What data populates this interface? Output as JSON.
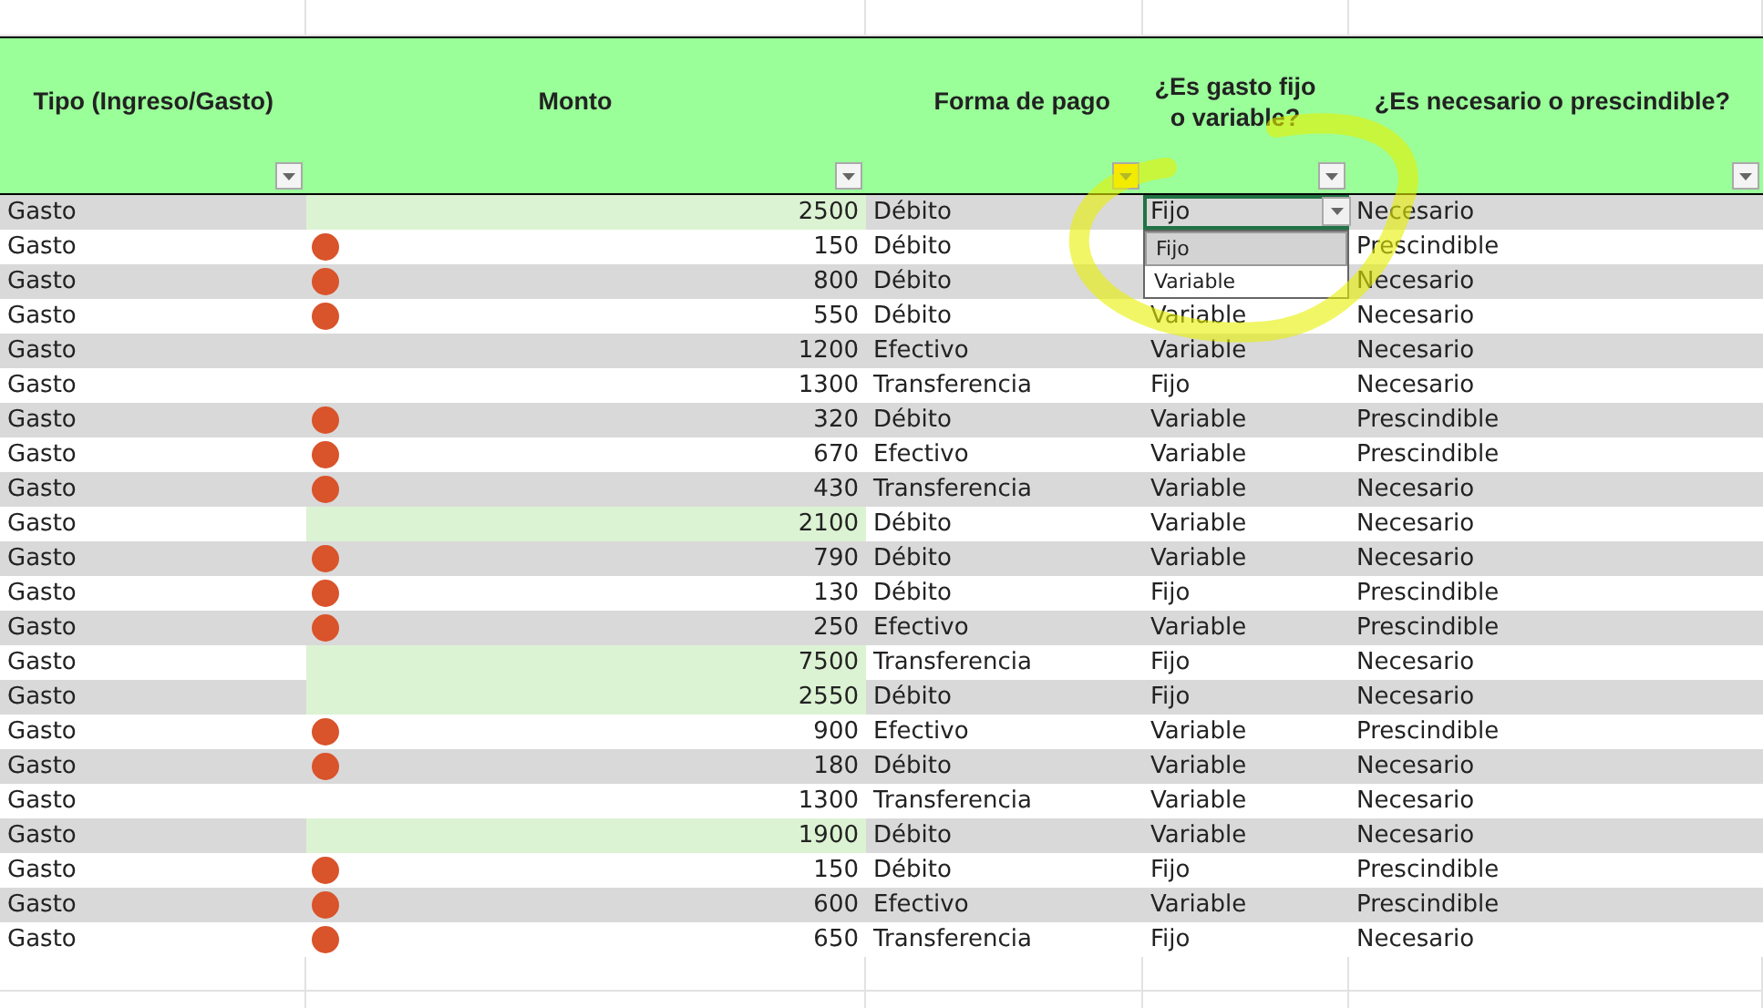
{
  "columns": [
    {
      "label": "Tipo (Ingreso/Gasto)",
      "filter_active": false
    },
    {
      "label": "Monto",
      "filter_active": false
    },
    {
      "label": "Forma de pago",
      "filter_active": true
    },
    {
      "label": "¿Es gasto fijo o variable?",
      "filter_active": false
    },
    {
      "label": "¿Es necesario o prescindible?",
      "filter_active": false
    }
  ],
  "rows": [
    {
      "tipo": "Gasto",
      "monto": "2500",
      "kind": "fill",
      "pago": "Débito",
      "fijo": "Fijo",
      "necesidad": "Necesario",
      "selected": true
    },
    {
      "tipo": "Gasto",
      "monto": "150",
      "kind": "dot",
      "pago": "Débito",
      "necesidad": "Prescindible",
      "selected": false
    },
    {
      "tipo": "Gasto",
      "monto": "800",
      "kind": "dot",
      "pago": "Débito",
      "necesidad": "Necesario",
      "selected": false
    },
    {
      "tipo": "Gasto",
      "monto": "550",
      "kind": "dot",
      "pago": "Débito",
      "fijo": "Variable",
      "necesidad": "Necesario",
      "selected": false
    },
    {
      "tipo": "Gasto",
      "monto": "1200",
      "kind": "none",
      "pago": "Efectivo",
      "fijo": "Variable",
      "necesidad": "Necesario",
      "selected": false
    },
    {
      "tipo": "Gasto",
      "monto": "1300",
      "kind": "none",
      "pago": "Transferencia",
      "fijo": "Fijo",
      "necesidad": "Necesario",
      "selected": false
    },
    {
      "tipo": "Gasto",
      "monto": "320",
      "kind": "dot",
      "pago": "Débito",
      "fijo": "Variable",
      "necesidad": "Prescindible",
      "selected": false
    },
    {
      "tipo": "Gasto",
      "monto": "670",
      "kind": "dot",
      "pago": "Efectivo",
      "fijo": "Variable",
      "necesidad": "Prescindible",
      "selected": false
    },
    {
      "tipo": "Gasto",
      "monto": "430",
      "kind": "dot",
      "pago": "Transferencia",
      "fijo": "Variable",
      "necesidad": "Necesario",
      "selected": false
    },
    {
      "tipo": "Gasto",
      "monto": "2100",
      "kind": "fill",
      "pago": "Débito",
      "fijo": "Variable",
      "necesidad": "Necesario",
      "selected": false
    },
    {
      "tipo": "Gasto",
      "monto": "790",
      "kind": "dot",
      "pago": "Débito",
      "fijo": "Variable",
      "necesidad": "Necesario",
      "selected": false
    },
    {
      "tipo": "Gasto",
      "monto": "130",
      "kind": "dot",
      "pago": "Débito",
      "fijo": "Fijo",
      "necesidad": "Prescindible",
      "selected": false
    },
    {
      "tipo": "Gasto",
      "monto": "250",
      "kind": "dot",
      "pago": "Efectivo",
      "fijo": "Variable",
      "necesidad": "Prescindible",
      "selected": false
    },
    {
      "tipo": "Gasto",
      "monto": "7500",
      "kind": "fill",
      "pago": "Transferencia",
      "fijo": "Fijo",
      "necesidad": "Necesario",
      "selected": false
    },
    {
      "tipo": "Gasto",
      "monto": "2550",
      "kind": "fill",
      "pago": "Débito",
      "fijo": "Fijo",
      "necesidad": "Necesario",
      "selected": false
    },
    {
      "tipo": "Gasto",
      "monto": "900",
      "kind": "dot",
      "pago": "Efectivo",
      "fijo": "Variable",
      "necesidad": "Prescindible",
      "selected": false
    },
    {
      "tipo": "Gasto",
      "monto": "180",
      "kind": "dot",
      "pago": "Débito",
      "fijo": "Variable",
      "necesidad": "Necesario",
      "selected": false
    },
    {
      "tipo": "Gasto",
      "monto": "1300",
      "kind": "none",
      "pago": "Transferencia",
      "fijo": "Variable",
      "necesidad": "Necesario",
      "selected": false
    },
    {
      "tipo": "Gasto",
      "monto": "1900",
      "kind": "fill",
      "pago": "Débito",
      "fijo": "Variable",
      "necesidad": "Necesario",
      "selected": false
    },
    {
      "tipo": "Gasto",
      "monto": "150",
      "kind": "dot",
      "pago": "Débito",
      "fijo": "Fijo",
      "necesidad": "Prescindible",
      "selected": false
    },
    {
      "tipo": "Gasto",
      "monto": "600",
      "kind": "dot",
      "pago": "Efectivo",
      "fijo": "Variable",
      "necesidad": "Prescindible",
      "selected": false
    },
    {
      "tipo": "Gasto",
      "monto": "650",
      "kind": "dot",
      "pago": "Transferencia",
      "fijo": "Fijo",
      "necesidad": "Necesario",
      "selected": false
    }
  ],
  "dropdown": {
    "options": [
      {
        "label": "Fijo",
        "selected": true
      },
      {
        "label": "Variable",
        "selected": false
      }
    ]
  }
}
